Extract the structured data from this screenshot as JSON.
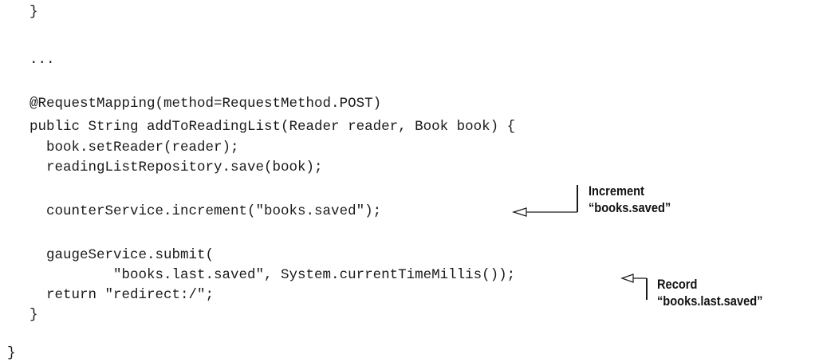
{
  "code": {
    "lines": [
      "}",
      "...",
      "@RequestMapping(method=RequestMethod.POST)",
      "public String addToReadingList(Reader reader, Book book) {",
      "  book.setReader(reader);",
      "  readingListRepository.save(book);",
      "  counterService.increment(\"books.saved\");",
      "  gaugeService.submit(",
      "          \"books.last.saved\", System.currentTimeMillis());",
      "  return \"redirect:/\";",
      "}",
      "}"
    ]
  },
  "annotations": {
    "increment": {
      "line1": "Increment",
      "line2": "“books.saved”"
    },
    "record": {
      "line1": "Record",
      "line2": "“books.last.saved”"
    }
  }
}
